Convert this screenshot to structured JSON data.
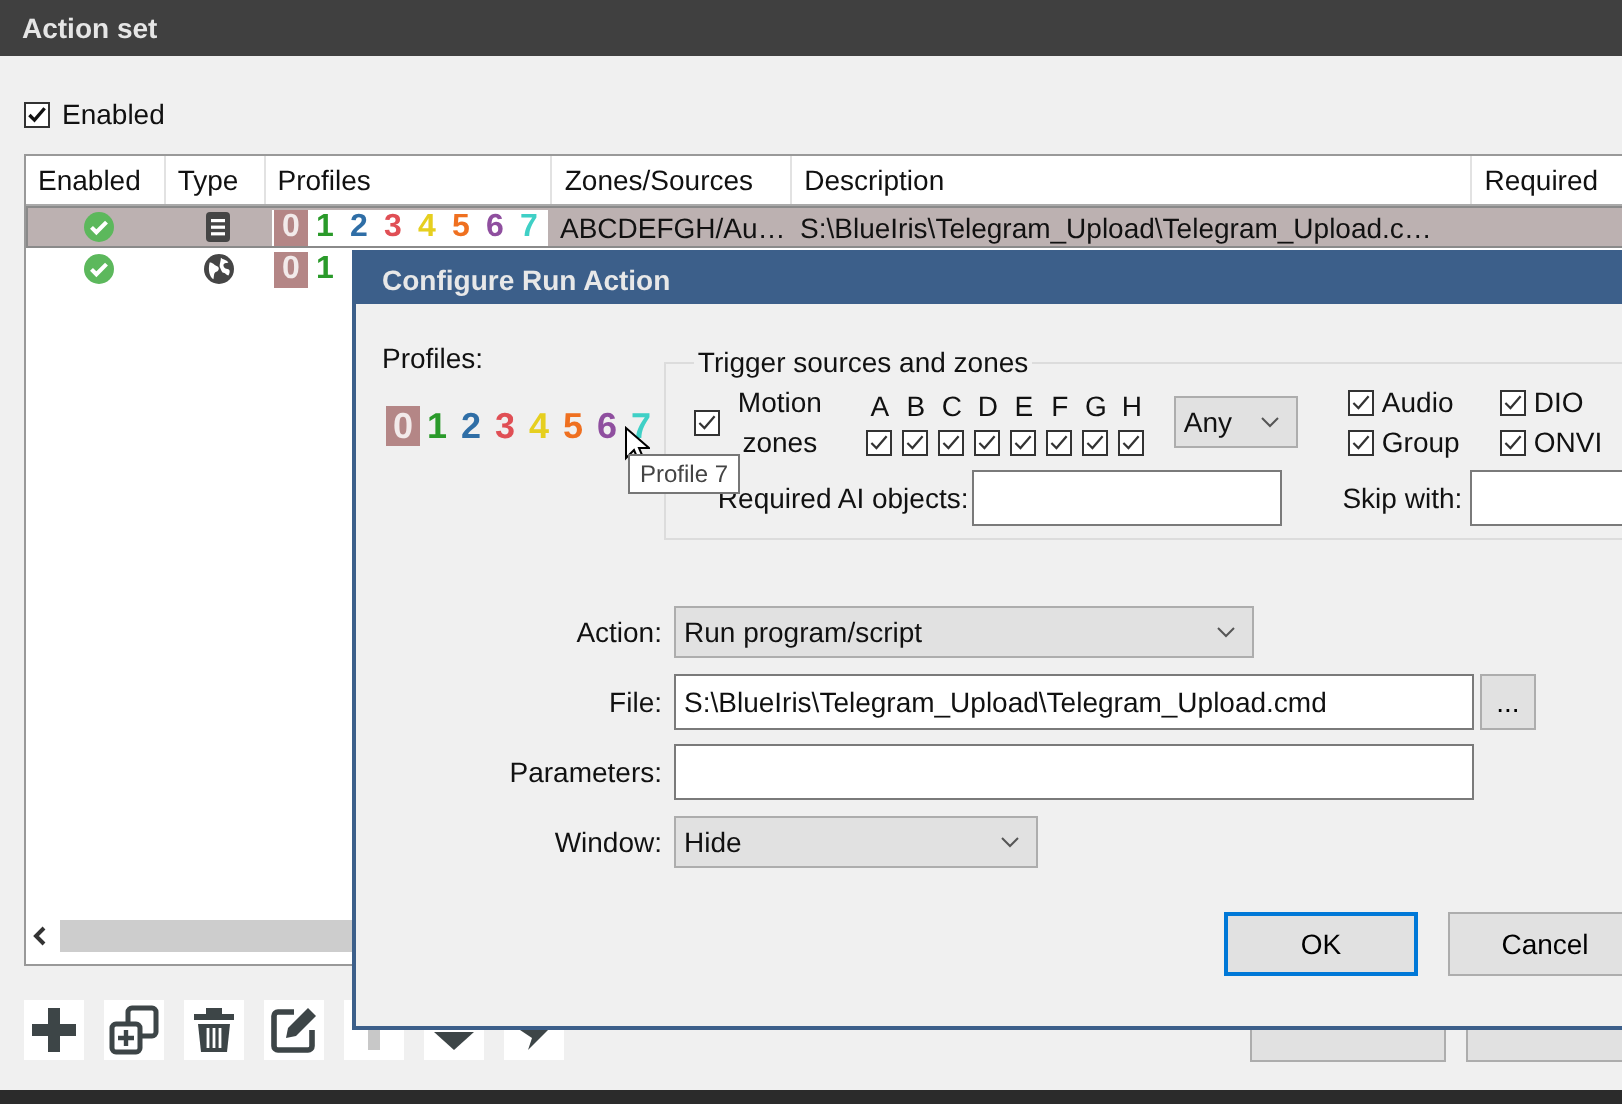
{
  "window": {
    "title": "Action set"
  },
  "enabled": {
    "label": "Enabled",
    "checked": true
  },
  "table": {
    "columns": [
      "Enabled",
      "Type",
      "Profiles",
      "Zones/Sources",
      "Description",
      "Required"
    ],
    "rows": [
      {
        "selected": true,
        "enabled": true,
        "kind": "script",
        "profiles": [
          {
            "label": "0",
            "active": false
          },
          {
            "label": "1",
            "active": true,
            "color": "#2a9a2a"
          },
          {
            "label": "2",
            "active": true,
            "color": "#2f6ea6"
          },
          {
            "label": "3",
            "active": true,
            "color": "#e04f55"
          },
          {
            "label": "4",
            "active": true,
            "color": "#e6cf1f"
          },
          {
            "label": "5",
            "active": true,
            "color": "#ef7020"
          },
          {
            "label": "6",
            "active": true,
            "color": "#8f4f9f"
          },
          {
            "label": "7",
            "active": true,
            "color": "#3fd0c6"
          }
        ],
        "zones": "ABCDEFGH/Au…",
        "description": "S:\\BlueIris\\Telegram_Upload\\Telegram_Upload.c…"
      },
      {
        "selected": false,
        "enabled": true,
        "kind": "web",
        "profiles": [
          {
            "label": "0",
            "active": false
          },
          {
            "label": "1",
            "active": true,
            "color": "#2a9a2a"
          }
        ]
      }
    ]
  },
  "toolbar": [
    {
      "kind": "add"
    },
    {
      "kind": "duplicate"
    },
    {
      "kind": "delete"
    },
    {
      "kind": "edit"
    },
    {
      "kind": "up"
    },
    {
      "kind": "down"
    },
    {
      "kind": "run"
    }
  ],
  "dialog": {
    "title": "Configure Run Action",
    "profiles_label": "Profiles:",
    "profiles": [
      {
        "label": "0",
        "active": false
      },
      {
        "label": "1",
        "active": true,
        "color": "#2a9a2a"
      },
      {
        "label": "2",
        "active": true,
        "color": "#2f6ea6"
      },
      {
        "label": "3",
        "active": true,
        "color": "#e04f55"
      },
      {
        "label": "4",
        "active": true,
        "color": "#e6cf1f"
      },
      {
        "label": "5",
        "active": true,
        "color": "#ef7020"
      },
      {
        "label": "6",
        "active": true,
        "color": "#8f4f9f"
      },
      {
        "label": "7",
        "active": true,
        "color": "#3fd0c6"
      }
    ],
    "tooltip": "Profile 7",
    "trigger": {
      "title": "Trigger sources and zones",
      "motion_label": "Motion zones",
      "motion_checked": true,
      "zones": [
        {
          "letter": "A",
          "checked": true
        },
        {
          "letter": "B",
          "checked": true
        },
        {
          "letter": "C",
          "checked": true
        },
        {
          "letter": "D",
          "checked": true
        },
        {
          "letter": "E",
          "checked": true
        },
        {
          "letter": "F",
          "checked": true
        },
        {
          "letter": "G",
          "checked": true
        },
        {
          "letter": "H",
          "checked": true
        }
      ],
      "match": "Any",
      "sources": [
        {
          "label": "Audio",
          "checked": true
        },
        {
          "label": "DIO",
          "checked": true
        },
        {
          "label": "Group",
          "checked": true
        },
        {
          "label": "ONVI",
          "checked": true
        }
      ],
      "ai_label": "Required AI objects:",
      "skip_label": "Skip with:"
    },
    "fields": [
      {
        "label": "Action:",
        "kind": "select",
        "value": "Run program/script"
      },
      {
        "label": "File:",
        "kind": "text",
        "value": "S:\\BlueIris\\Telegram_Upload\\Telegram_Upload.cmd",
        "browse": "..."
      },
      {
        "label": "Parameters:",
        "kind": "text"
      },
      {
        "label": "Window:",
        "kind": "select",
        "value": "Hide"
      }
    ],
    "buttons": [
      {
        "label": "OK",
        "default": true
      },
      {
        "label": "Cancel",
        "default": false
      }
    ]
  }
}
